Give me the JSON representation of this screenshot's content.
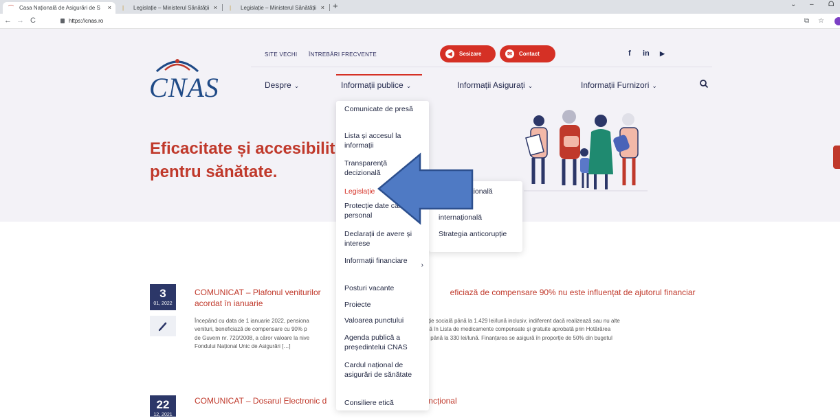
{
  "browser": {
    "tabs": [
      {
        "title": "Casa Națională de Asigurări de S",
        "close": "×"
      },
      {
        "title": "Legislație – Ministerul Sănătății",
        "close": "×"
      },
      {
        "title": "Legislație – Ministerul Sănătății",
        "close": "×"
      }
    ],
    "new_tab": "+",
    "url": "https://cnas.ro",
    "window_controls": {
      "minimize": "–",
      "maximize": "ᗝ",
      "dropdown": "⌄"
    }
  },
  "site": {
    "logo": "CNAS",
    "top_links": [
      "SITE VECHI",
      "ÎNTREBĂRI FRECVENTE"
    ],
    "buttons": {
      "sesizare": "Sesizare",
      "contact": "Contact"
    },
    "social": {
      "facebook": "f",
      "linkedin": "in",
      "youtube": "▶"
    },
    "menu": [
      {
        "label": "Despre"
      },
      {
        "label": "Informații publice"
      },
      {
        "label": "Informații Asigurați"
      },
      {
        "label": "Informații Furnizori"
      }
    ],
    "hero_title": "Eficacitate și accesibilit pentru sănătate.",
    "hero_line1": "Eficacitate și accesibilit",
    "hero_line2": "pentru sănătate."
  },
  "dropdown": {
    "items": [
      "Comunicate de presă",
      "Lista și accesul la informații",
      "Transparență decizională",
      "Legislație",
      "Protecție date caracter personal",
      "Declarații de avere și interese",
      "Informații financiare",
      "Posturi vacante",
      "Proiecte",
      "Valoarea punctului",
      "Agenda publică a președintelui CNAS",
      "Cardul național de asigurări de sănătate",
      "Consiliere etică"
    ],
    "selected": "Legislație",
    "submenu": [
      "Legislație națională",
      "Legislație internațională",
      "Strategia anticorupție"
    ],
    "submenu_visible": [
      "națională",
      "internațională",
      "Strategia anticorupție"
    ]
  },
  "news": [
    {
      "day": "3",
      "month_year": "01, 2022",
      "title_line1": "COMUNICAT – Plafonul veniturilor",
      "title_line1b": "eficiază de compensare 90% nu este influențat de ajutorul financiar",
      "title_line2": "acordat în ianuarie",
      "body_lines": [
        [
          "Începând cu data de 1 ianuarie 2022, pensiona",
          "mnizație socială până la 1.429 lei/lună inclusiv, indiferent dacă realizează sau nu alte"
        ],
        [
          "venituri, beneficiază de compensare cu 90% p",
          "lista B cuprinsă în Lista de medicamente compensate și gratuite aprobată prin Hotărârea"
        ],
        [
          "de Guvern nr. 720/2008, a căror valoare la nive",
          "ripție este de până la 330 lei/lună. Finanțarea se asigură în proporție de 50% din bugetul"
        ],
        [
          "Fondului Național Unic de Asigurări […]",
          ""
        ]
      ]
    },
    {
      "day": "22",
      "month_year": "12, 2021",
      "title_line1": "COMUNICAT – Dosarul Electronic d",
      "title_line1b": "funcțional"
    }
  ]
}
